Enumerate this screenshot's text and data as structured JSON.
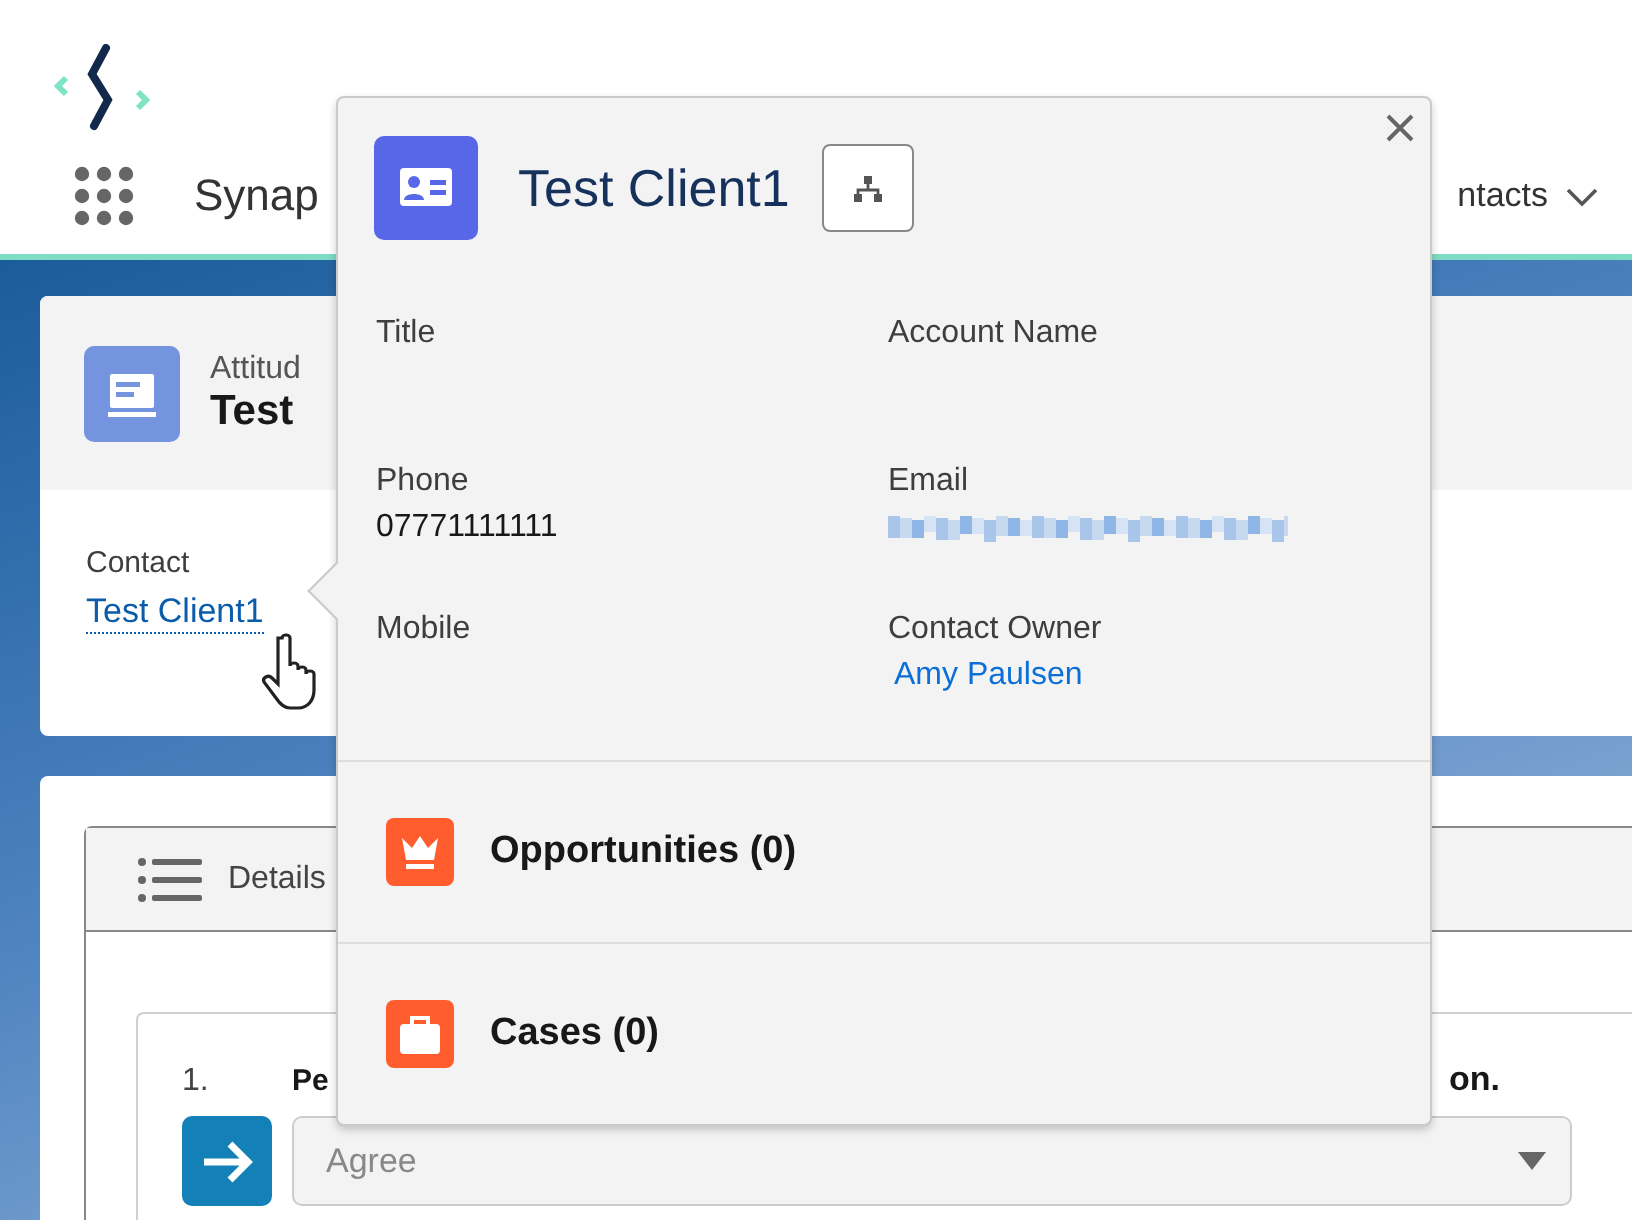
{
  "app_header": {
    "app_name": "Synap",
    "nav_item": "ntacts"
  },
  "record_header": {
    "object_type": "Attitud",
    "record_name": "Test"
  },
  "contact_field": {
    "label": "Contact",
    "value": "Test Client1"
  },
  "details_tab": {
    "label": "Details"
  },
  "question": {
    "number": "1.",
    "text_start": "Pe",
    "text_end": "on.",
    "answer": "Agree"
  },
  "hover_card": {
    "title": "Test Client1",
    "fields": [
      {
        "label": "Title",
        "kind": "text"
      },
      {
        "label": "Account Name",
        "kind": "text"
      },
      {
        "label": "Phone",
        "kind": "text",
        "value": "07771111111"
      },
      {
        "label": "Email",
        "kind": "blurred"
      },
      {
        "label": "Mobile",
        "kind": "text"
      },
      {
        "label": "Contact Owner",
        "kind": "link",
        "value": "Amy Paulsen"
      }
    ],
    "related": [
      {
        "label": "Opportunities (0)",
        "kind": "opportunity"
      },
      {
        "label": "Cases (0)",
        "kind": "case"
      }
    ]
  }
}
